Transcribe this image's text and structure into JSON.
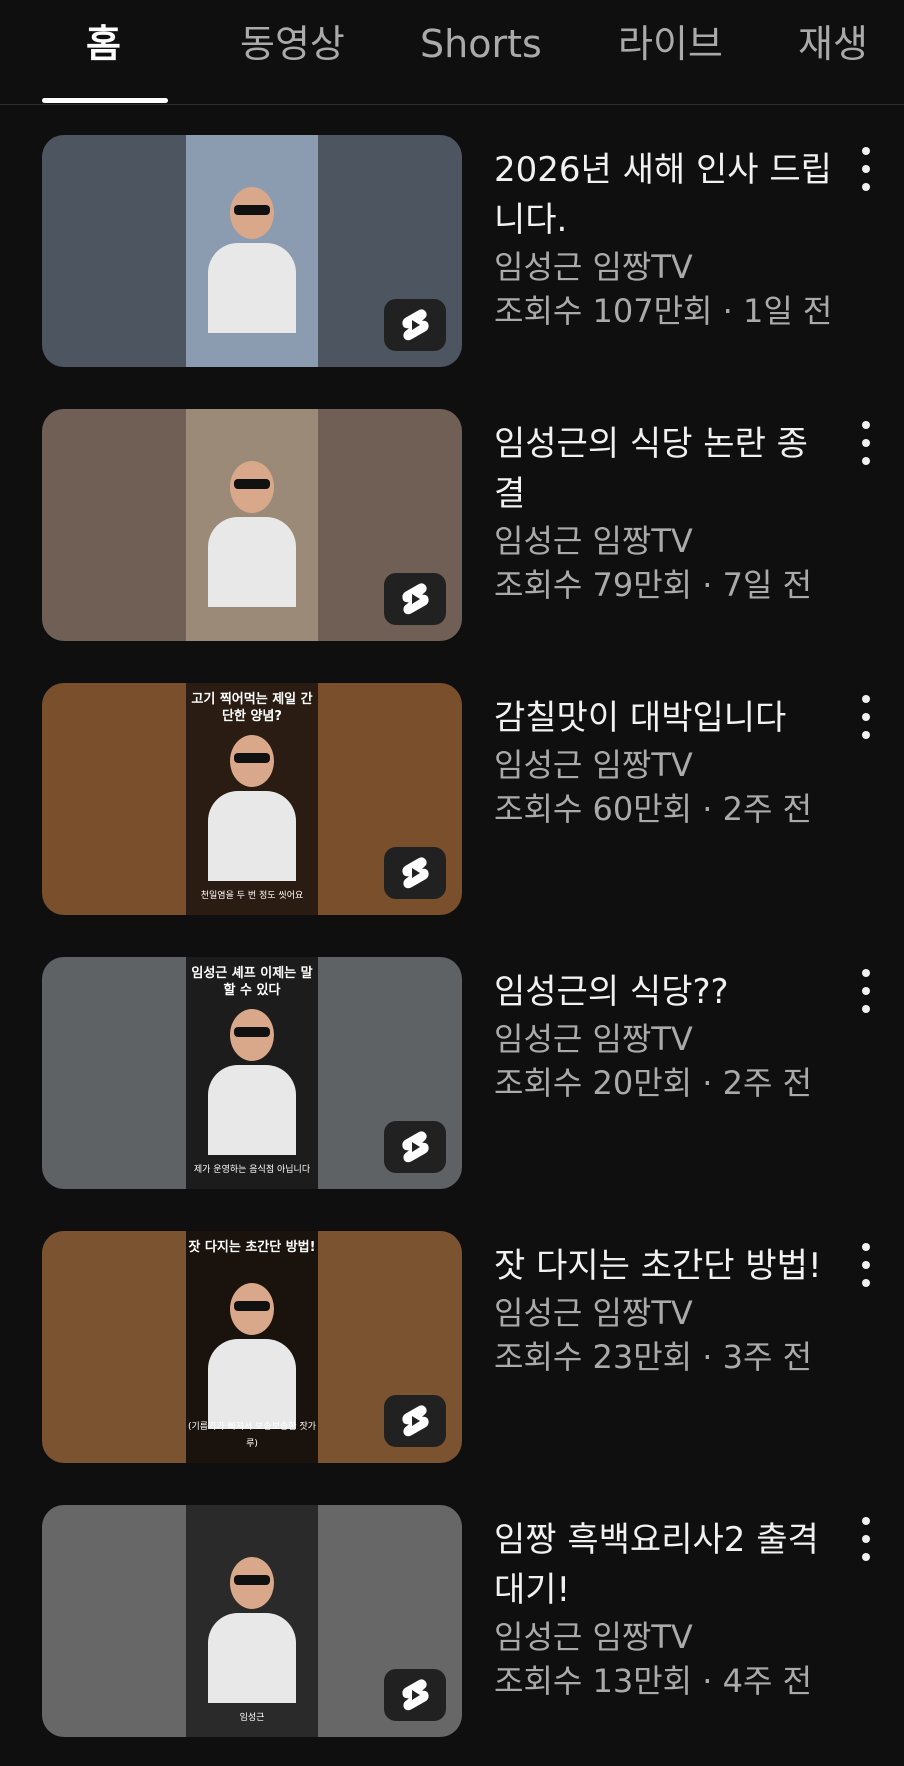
{
  "tabs": [
    {
      "label": "홈",
      "active": true
    },
    {
      "label": "동영상",
      "active": false
    },
    {
      "label": "Shorts",
      "active": false
    },
    {
      "label": "라이브",
      "active": false
    },
    {
      "label": "재생",
      "active": false
    }
  ],
  "videos": [
    {
      "title": "2026년 새해 인사 드립니다.",
      "channel": "임성근 임짱TV",
      "stats": "조회수 107만회 · 1일 전",
      "bg": "#4d5561",
      "center": "#8b9bb0",
      "caption_top": "",
      "caption_bottom": ""
    },
    {
      "title": "임성근의 식당 논란 종결",
      "channel": "임성근 임짱TV",
      "stats": "조회수 79만회 · 7일 전",
      "bg": "#6f5f55",
      "center": "#9c8a78",
      "caption_top": "",
      "caption_bottom": ""
    },
    {
      "title": "감칠맛이 대박입니다",
      "channel": "임성근 임짱TV",
      "stats": "조회수 60만회 · 2주 전",
      "bg": "#7a4f2c",
      "center": "#2a1c12",
      "caption_top": "고기 찍어먹는 제일 간단한 양념?",
      "caption_bottom": "천일염을 두 번 정도 씻어요"
    },
    {
      "title": "임성근의 식당??",
      "channel": "임성근 임짱TV",
      "stats": "조회수 20만회 · 2주 전",
      "bg": "#5f6265",
      "center": "#1c1c1c",
      "caption_top": "임성근 셰프 이제는 말할 수 있다",
      "caption_bottom": "제가 운영하는 음식점 아닙니다"
    },
    {
      "title": "잣 다지는 초간단 방법!",
      "channel": "임성근 임짱TV",
      "stats": "조회수 23만회 · 3주 전",
      "bg": "#7c5330",
      "center": "#1a120c",
      "caption_top": "잣 다지는 초간단 방법!",
      "caption_bottom": "(기름기가 빠져서 보송보송한 잣가루)"
    },
    {
      "title": "임짱 흑백요리사2 출격대기!",
      "channel": "임성근 임짱TV",
      "stats": "조회수 13만회 · 4주 전",
      "bg": "#676767",
      "center": "#2a2a2a",
      "caption_top": "",
      "caption_bottom": "임성근"
    }
  ]
}
